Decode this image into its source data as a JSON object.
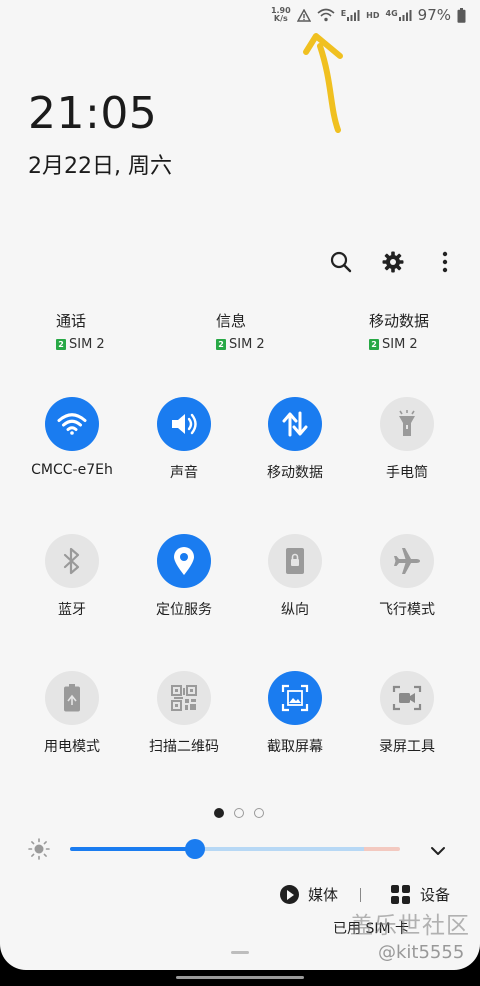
{
  "status_bar": {
    "net_speed_value": "1.90",
    "net_speed_unit": "K/s",
    "sim_type": "E",
    "hd": "HD",
    "lte": "4G",
    "battery": "97%"
  },
  "lockscreen": {
    "time": "21:05",
    "date": "2月22日, 周六"
  },
  "sim_prefs": [
    {
      "label": "通话",
      "sim": "SIM 2",
      "badge": "2"
    },
    {
      "label": "信息",
      "sim": "SIM 2",
      "badge": "2"
    },
    {
      "label": "移动数据",
      "sim": "SIM 2",
      "badge": "2"
    }
  ],
  "tiles": [
    {
      "label": "CMCC-e7Eh",
      "icon": "wifi-icon",
      "on": true
    },
    {
      "label": "声音",
      "icon": "volume-icon",
      "on": true
    },
    {
      "label": "移动数据",
      "icon": "mobile-data-icon",
      "on": true
    },
    {
      "label": "手电筒",
      "icon": "flashlight-icon",
      "on": false
    },
    {
      "label": "蓝牙",
      "icon": "bluetooth-icon",
      "on": false
    },
    {
      "label": "定位服务",
      "icon": "location-icon",
      "on": true
    },
    {
      "label": "纵向",
      "icon": "portrait-lock-icon",
      "on": false
    },
    {
      "label": "飞行模式",
      "icon": "airplane-icon",
      "on": false
    },
    {
      "label": "用电模式",
      "icon": "power-mode-icon",
      "on": false
    },
    {
      "label": "扫描二维码",
      "icon": "qr-code-icon",
      "on": false
    },
    {
      "label": "截取屏幕",
      "icon": "screenshot-icon",
      "on": true
    },
    {
      "label": "录屏工具",
      "icon": "screen-record-icon",
      "on": false
    }
  ],
  "pager": {
    "pages": 3,
    "active": 0
  },
  "brightness": {
    "level": 0.38
  },
  "media": {
    "media_label": "媒体",
    "device_label": "设备"
  },
  "footer": {
    "status": "已用 SIM 卡",
    "watermark_1": "盖乐世社区",
    "watermark_2": "@kit5555"
  },
  "colors": {
    "accent": "#1a7cf0",
    "annotation": "#f0c020"
  }
}
